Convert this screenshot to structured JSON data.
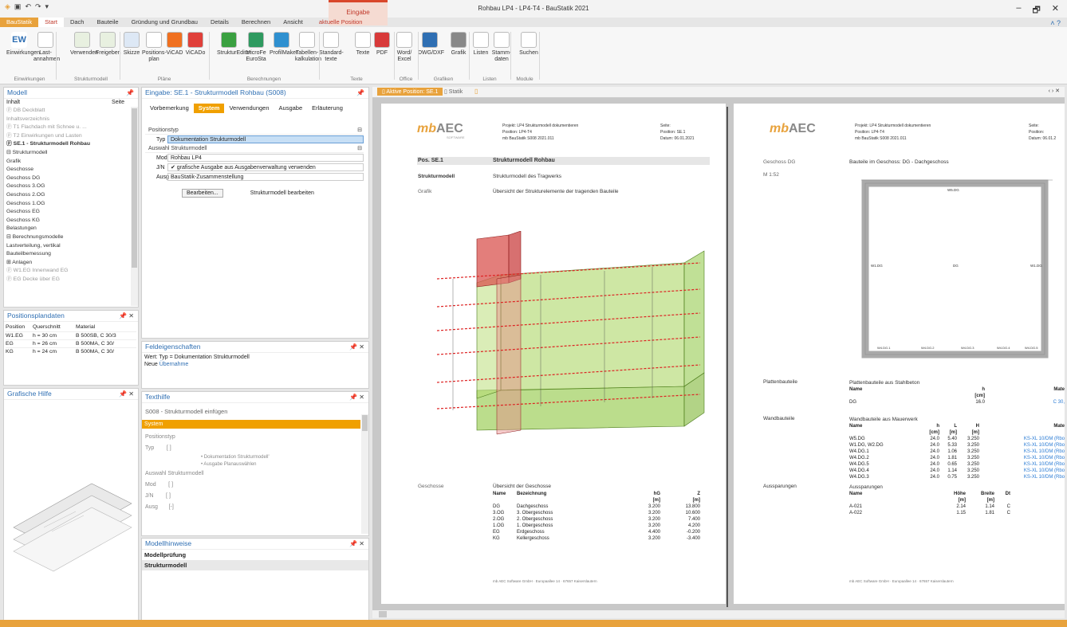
{
  "app": {
    "window_title": "Rohbau LP4 - LP4-T4 - BauStatik 2021",
    "context_group": "Eingabe",
    "qat_icons": [
      "app-icon",
      "save-icon",
      "undo-icon",
      "redo-icon",
      "customize-icon"
    ],
    "window_controls": [
      "–",
      "🗗",
      "✕"
    ]
  },
  "tabs": [
    "BauStatik",
    "Start",
    "Dach",
    "Bauteile",
    "Gründung und Grundbau",
    "Details",
    "Berechnen",
    "Ansicht",
    "aktuelle Position"
  ],
  "ribbon": {
    "buttons": [
      {
        "label": "Einwirkungen",
        "sub": "EW",
        "icon": "einwirkungen-icon"
      },
      {
        "label": "Last-\nannahmen",
        "icon": "lastannahmen-icon"
      },
      {
        "label": "Verwenden",
        "icon": "verwenden-icon"
      },
      {
        "label": "Freigeben",
        "icon": "freigeben-icon"
      },
      {
        "label": "Skizze",
        "icon": "skizze-icon"
      },
      {
        "label": "Positions-\nplan",
        "icon": "positionsplan-icon"
      },
      {
        "label": "ViCAD",
        "icon": "vicad-icon"
      },
      {
        "label": "ViCADo",
        "icon": "vicado-icon"
      },
      {
        "label": "StrukturEditor",
        "icon": "struktureditor-icon"
      },
      {
        "label": "MicroFe\nEuroSta",
        "icon": "microfe-icon"
      },
      {
        "label": "ProfilMaker",
        "icon": "profilmaker-icon"
      },
      {
        "label": "Tabellen-\nkalkulation",
        "icon": "tabellen-icon"
      },
      {
        "label": "Standard-\ntexte",
        "icon": "standardtexte-icon"
      },
      {
        "label": "Texte",
        "icon": "txt-icon"
      },
      {
        "label": "PDF",
        "icon": "pdf-icon"
      },
      {
        "label": "Word/\nExcel",
        "icon": "word-excel-icon"
      },
      {
        "label": "DWG/DXF",
        "icon": "dwg-icon"
      },
      {
        "label": "Grafik",
        "icon": "bmp-icon"
      },
      {
        "label": "Listen",
        "icon": "listen-icon"
      },
      {
        "label": "Stamm-\ndaten",
        "icon": "stammdaten-icon"
      },
      {
        "label": "Suchen",
        "icon": "suchen-icon"
      }
    ],
    "groups": [
      "Einwirkungen",
      "Strukturmodell",
      "Pläne",
      "Berechnungen",
      "Texte",
      "Office",
      "Grafiken",
      "Listen",
      "Module"
    ]
  },
  "modell": {
    "title": "Modell",
    "col_inhalt": "Inhalt",
    "col_seite": "Seite",
    "items": [
      {
        "t": "ⓟ DB  Deckblatt",
        "c": "g"
      },
      {
        "t": "   Inhaltsverzeichnis",
        "c": "g"
      },
      {
        "t": "ⓟ T1  Flachdach mit Schnee u. ...",
        "c": "g"
      },
      {
        "t": "ⓟ T2  Einwirkungen und Lasten",
        "c": "g"
      },
      {
        "t": "ⓟ SE.1 - Strukturmodell Rohbau",
        "c": "b"
      },
      {
        "t": "  ⊟ Strukturmodell",
        "c": ""
      },
      {
        "t": "        Grafik",
        "c": ""
      },
      {
        "t": "        Geschosse",
        "c": ""
      },
      {
        "t": "        Geschoss DG",
        "c": ""
      },
      {
        "t": "        Geschoss 3.OG",
        "c": ""
      },
      {
        "t": "        Geschoss 2.OG",
        "c": ""
      },
      {
        "t": "        Geschoss 1.OG",
        "c": ""
      },
      {
        "t": "        Geschoss EG",
        "c": ""
      },
      {
        "t": "        Geschoss KG",
        "c": ""
      },
      {
        "t": "        Belastungen",
        "c": ""
      },
      {
        "t": "  ⊟ Berechnungsmodelle",
        "c": ""
      },
      {
        "t": "        Lastverteilung, vertikal",
        "c": ""
      },
      {
        "t": "        Bauteilbemessung",
        "c": ""
      },
      {
        "t": "  ⊞ Anlagen",
        "c": ""
      },
      {
        "t": "ⓟ W1.EG  Innenwand EG",
        "c": "g"
      },
      {
        "t": "ⓟ EG  Decke über EG",
        "c": "g"
      }
    ]
  },
  "positionsplandaten": {
    "title": "Positionsplandaten",
    "headers": [
      "Position",
      "Querschnitt",
      "Material"
    ],
    "rows": [
      [
        "W1.EG",
        "h = 30 cm",
        "B 500SB, C 30/3"
      ],
      [
        "EG",
        "h = 26 cm",
        "B 500MA, C 30/"
      ],
      [
        "KG",
        "h = 24 cm",
        "B 500MA, C 30/"
      ]
    ]
  },
  "grafische_hilfe": {
    "title": "Grafische Hilfe"
  },
  "eingabe": {
    "title": "Eingabe: SE.1 - Strukturmodell Rohbau (S008)",
    "subtabs": [
      "Vorbemerkung",
      "System",
      "Verwendungen",
      "Ausgabe",
      "Erläuterung"
    ],
    "sec1": "Positionstyp",
    "typ_label": "Typ",
    "typ_value": "Dokumentation Strukturmodell",
    "sec2": "Auswahl Strukturmodell",
    "mod_label": "Mod",
    "mod_value": "Rohbau LP4",
    "jn_label": "J/N",
    "jn_value": "✔  grafische Ausgabe aus Ausgabenverwaltung verwenden",
    "ausg_label": "Ausg",
    "ausg_value": "BauStatik-Zusammenstellung",
    "edit_button": "Bearbeiten...",
    "edit_text": "Strukturmodell bearbeiten"
  },
  "feld": {
    "title": "Feldeigenschaften",
    "wert": "Wert: Typ = Dokumentation Strukturmodell",
    "neue": "Neue",
    "link": "Übernahme"
  },
  "texthilfe": {
    "title": "Texthilfe",
    "heading": "S008 - Strukturmodell einfügen",
    "bar": "System",
    "lines": [
      "Positionstyp",
      "Typ        [ ]",
      "• Dokumentation Strukturmodell'",
      "• Ausgabe Planauswählen",
      "Auswahl Strukturmodell",
      "Mod        [ ]",
      "J/N        [ ]",
      "Ausg       [-]"
    ]
  },
  "modellhinweise": {
    "title": "Modellhinweise",
    "items": [
      "Modellprüfung",
      "Strukturmodell"
    ]
  },
  "doctabs": [
    "Aktive Position: SE.1",
    "Statik"
  ],
  "page1": {
    "logo": "mb AEC",
    "logo_sub": "SOFTWARE",
    "header": [
      "Projekt:  LP4 Strukturmodell dokumentieren",
      "Position:  LP4-T4",
      "mb BauStatik S008 2021.011"
    ],
    "header_r": [
      "Seite:",
      "Position:      SE.1",
      "Datum:  06.01.2021"
    ],
    "pos": "Pos. SE.1",
    "pos_title": "Strukturmodell Rohbau",
    "l1": "Strukturmodell",
    "r1": "Strukturmodell des Tragwerks",
    "l2": "Grafik",
    "r2": "Übersicht der Strukturelemente der tragenden Bauteile",
    "l3": "Geschosse",
    "r3": "Übersicht der Geschosse",
    "th": [
      "Name",
      "Bezeichnung",
      "hG",
      "Z"
    ],
    "tu": [
      "",
      "",
      "[m]",
      "[m]"
    ],
    "rows": [
      [
        "DG",
        "Dachgeschoss",
        "3.200",
        "13.800"
      ],
      [
        "3.OG",
        "3. Obergeschoss",
        "3.200",
        "10.600"
      ],
      [
        "2.OG",
        "2. Obergeschoss",
        "3.200",
        "7.400"
      ],
      [
        "1.OG",
        "1. Obergeschoss",
        "3.200",
        "4.200"
      ],
      [
        "EG",
        "Erdgeschoss",
        "4.400",
        "-0.200"
      ],
      [
        "KG",
        "Kellergeschoss",
        "3.200",
        "-3.400"
      ]
    ],
    "footer": "mb AEC Software GmbH · Europaallee 14 · 67657 Kaiserslautern"
  },
  "page2": {
    "header": [
      "Projekt:  LP4 Strukturmodell dokumentieren",
      "Position:  LP4-T4",
      "mb BauStatik S008 2021.011"
    ],
    "header_r": [
      "Seite:",
      "Position:",
      "Datum:  06.01.2"
    ],
    "geschoss": "Geschoss DG",
    "geschoss_r": "Bauteile im Geschoss: DG - Dachgeschoss",
    "scale": "M 1:52",
    "plan_labels": [
      "W5.DG",
      "W1.DG",
      "DG",
      "W1.DG",
      "W4.DG.1",
      "W4.DG.2",
      "W4.DG.3",
      "W4.DG.4",
      "W4.DG.5"
    ],
    "platten": "Plattenbauteile",
    "platten_r": "Plattenbauteile aus Stahlbeton",
    "pt_head": [
      "Name",
      "h",
      "Mate"
    ],
    "pt_unit": [
      "",
      "[cm]",
      ""
    ],
    "pt_rows": [
      [
        "DG",
        "16.0",
        "C 30,"
      ]
    ],
    "wand": "Wandbauteile",
    "wand_r": "Wandbauteile aus Mauerwerk",
    "wt_head": [
      "Name",
      "h",
      "L",
      "H",
      "Mate"
    ],
    "wt_unit": [
      "",
      "[cm]",
      "[m]",
      "[m]",
      ""
    ],
    "wt_rows": [
      [
        "W5.DG",
        "24.0",
        "5.40",
        "3.250",
        "KS-XL 10/DM (Rbo"
      ],
      [
        "W1.DG, W2.DG",
        "24.0",
        "5.33",
        "3.250",
        "KS-XL 10/DM (Rbo"
      ],
      [
        "W4.DG.1",
        "24.0",
        "1.06",
        "3.250",
        "KS-XL 10/DM (Rbo"
      ],
      [
        "W4.DG.2",
        "24.0",
        "1.81",
        "3.250",
        "KS-XL 10/DM (Rbo"
      ],
      [
        "W4.DG.5",
        "24.0",
        "0.65",
        "3.250",
        "KS-XL 10/DM (Rbo"
      ],
      [
        "W4.DG.4",
        "24.0",
        "1.14",
        "3.250",
        "KS-XL 10/DM (Rbo"
      ],
      [
        "W4.DG.3",
        "24.0",
        "0.75",
        "3.250",
        "KS-XL 10/DM (Rbo"
      ]
    ],
    "aus": "Aussparungen",
    "aus_r": "Aussparungen",
    "at_head": [
      "Name",
      "Höhe",
      "Breite",
      "Dt"
    ],
    "at_unit": [
      "",
      "[m]",
      "[m]",
      ""
    ],
    "at_rows": [
      [
        "A-021",
        "2.14",
        "1.14",
        "C"
      ],
      [
        "A-022",
        "1.15",
        "1.81",
        "C"
      ]
    ],
    "footer": "mb AEC Software GmbH · Europaallee 14 · 67657 Kaiserslautern"
  },
  "colors": {
    "accent": "#e8a23c",
    "ctx": "#d9472b",
    "green": "#8dc63f",
    "red": "#d83a3a",
    "link": "#2f6fb3"
  }
}
